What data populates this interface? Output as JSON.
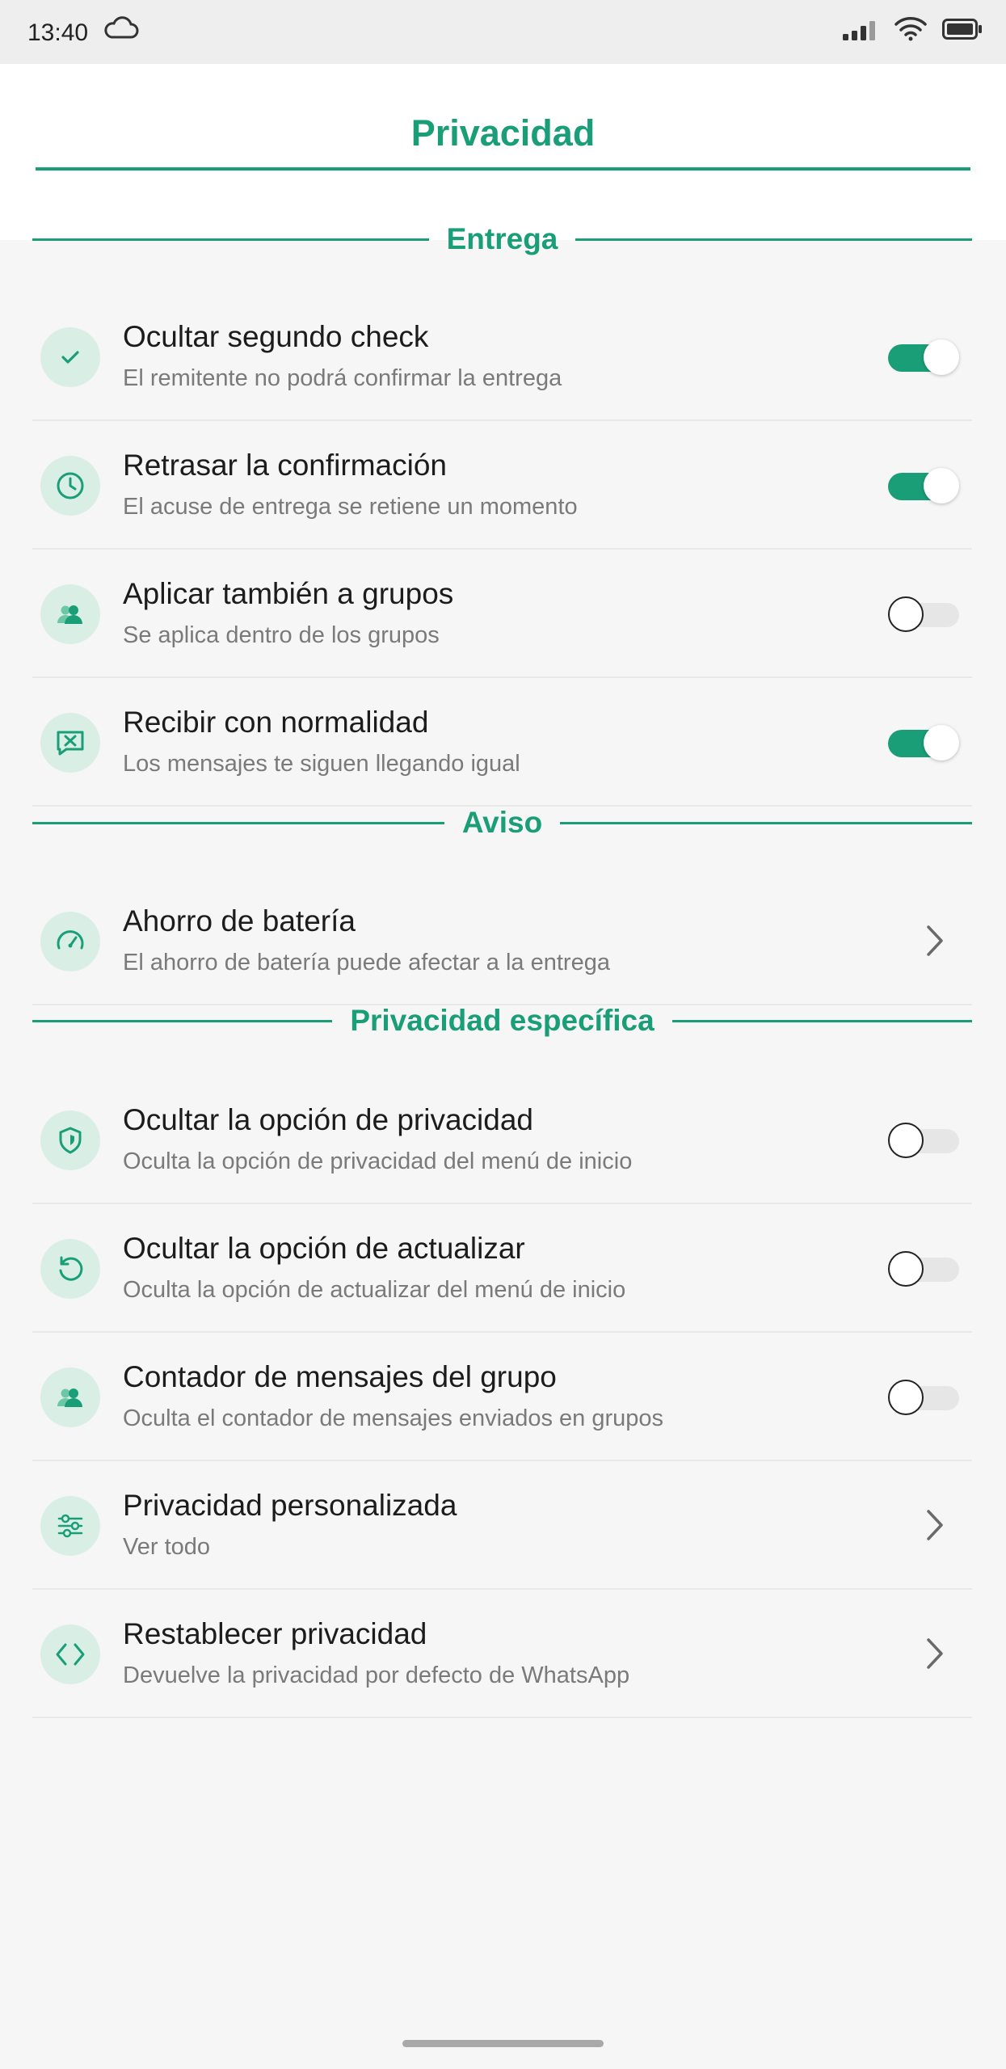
{
  "status_bar": {
    "time": "13:40",
    "icons": [
      "cloud-icon",
      "signal-icon",
      "wifi-icon",
      "battery-icon"
    ]
  },
  "header": {
    "title": "Privacidad"
  },
  "colors": {
    "accent": "#1a9e78",
    "icon_bg": "#d9efe6",
    "background": "#f6f6f6"
  },
  "sections": {
    "entrega": {
      "label": "Entrega",
      "items": [
        {
          "title": "Ocultar segundo check",
          "subtitle": "El remitente no podrá confirmar la entrega",
          "icon": "check-icon",
          "control": "toggle",
          "on": true
        },
        {
          "title": "Retrasar la confirmación",
          "subtitle": "El acuse de entrega se retiene un momento",
          "icon": "clock-icon",
          "control": "toggle",
          "on": true
        },
        {
          "title": "Aplicar también a grupos",
          "subtitle": "Se aplica dentro de los grupos",
          "icon": "group-icon",
          "control": "toggle",
          "on": false
        },
        {
          "title": "Recibir con normalidad",
          "subtitle": "Los mensajes te siguen llegando igual",
          "icon": "message-x-icon",
          "control": "toggle",
          "on": true
        }
      ]
    },
    "aviso": {
      "label": "Aviso",
      "items": [
        {
          "title": "Ahorro de batería",
          "subtitle": "El ahorro de batería puede afectar a la entrega",
          "icon": "gauge-icon",
          "control": "chevron"
        }
      ]
    },
    "especifica": {
      "label": "Privacidad específica",
      "items": [
        {
          "title": "Ocultar la opción de privacidad",
          "subtitle": "Oculta la opción de privacidad del menú de inicio",
          "icon": "shield-icon",
          "control": "toggle",
          "on": false
        },
        {
          "title": "Ocultar la opción de actualizar",
          "subtitle": "Oculta la opción de actualizar del menú de inicio",
          "icon": "refresh-icon",
          "control": "toggle",
          "on": false
        },
        {
          "title": "Contador de mensajes del grupo",
          "subtitle": "Oculta el contador de mensajes enviados en grupos",
          "icon": "group-icon",
          "control": "toggle",
          "on": false
        },
        {
          "title": "Privacidad personalizada",
          "subtitle": "Ver todo",
          "icon": "sliders-icon",
          "control": "chevron"
        },
        {
          "title": "Restablecer privacidad",
          "subtitle": "Devuelve la privacidad por defecto de WhatsApp",
          "icon": "code-icon",
          "control": "chevron"
        }
      ]
    }
  }
}
